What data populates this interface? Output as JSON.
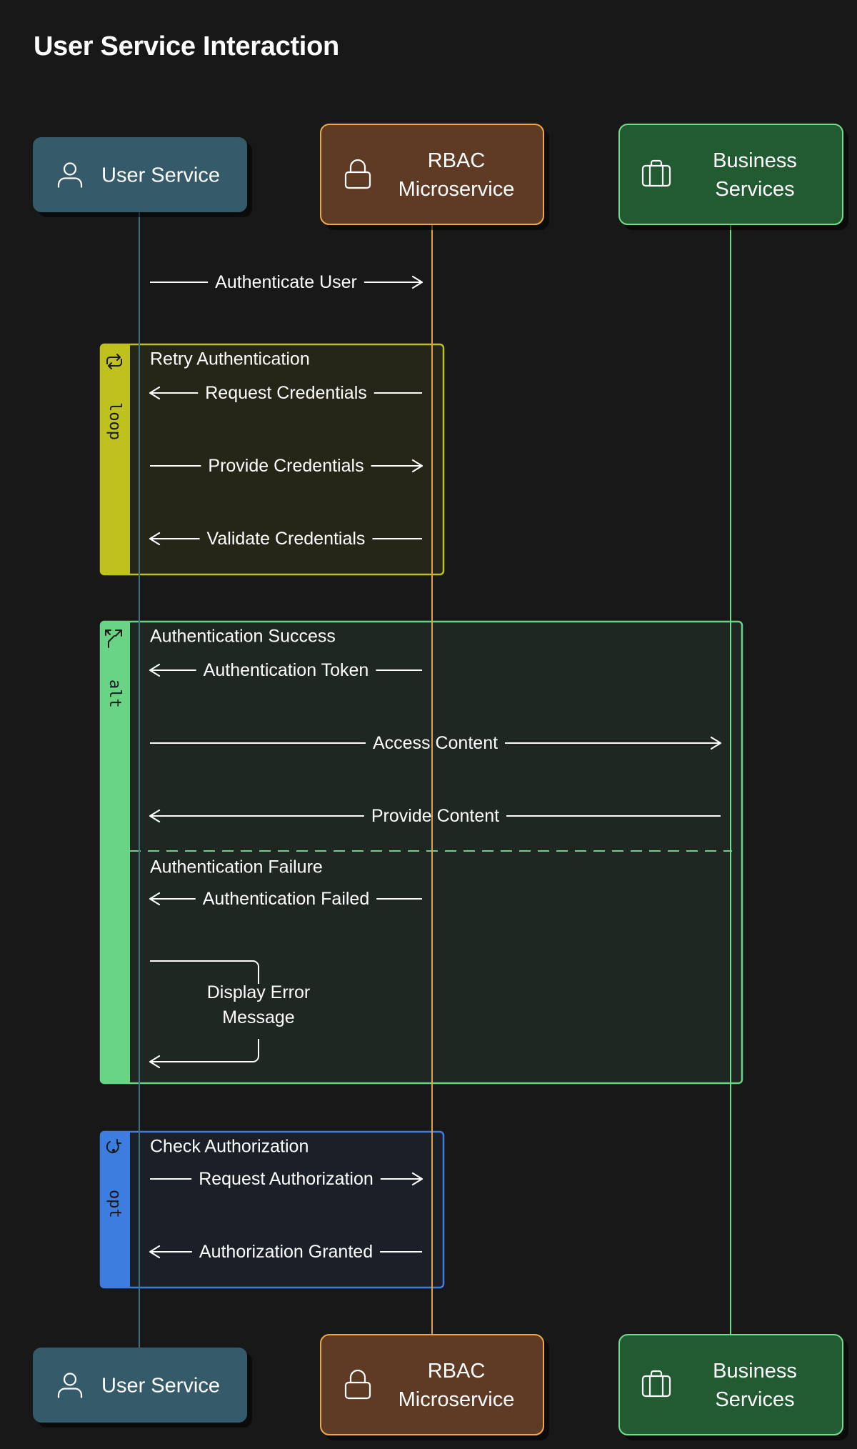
{
  "title": "User Service Interaction",
  "colors": {
    "background": "#181818",
    "user_service": {
      "fill": "#345a6b",
      "stroke": "#345a6b",
      "lifeline": "#3d6f7e"
    },
    "rbac": {
      "fill": "#5e3b26",
      "stroke": "#f0a745",
      "lifeline": "#e3a04a"
    },
    "business": {
      "fill": "#245a30",
      "stroke": "#6fdc8c",
      "lifeline": "#6fdc8c"
    },
    "loop": "#bfc11f",
    "alt": "#69d386",
    "opt": "#3e7de0"
  },
  "participants": [
    {
      "id": "user",
      "name": "User Service",
      "lines": [
        "User Service"
      ],
      "icon": "user-icon"
    },
    {
      "id": "rbac",
      "name": "RBAC Microservice",
      "lines": [
        "RBAC",
        "Microservice"
      ],
      "icon": "lock-icon"
    },
    {
      "id": "biz",
      "name": "Business Services",
      "lines": [
        "Business",
        "Services"
      ],
      "icon": "briefcase-icon"
    }
  ],
  "messages": [
    {
      "id": "authenticate-user",
      "from": "user",
      "to": "rbac",
      "label": "Authenticate User"
    },
    {
      "id": "request-credentials",
      "from": "rbac",
      "to": "user",
      "label": "Request Credentials"
    },
    {
      "id": "provide-credentials",
      "from": "user",
      "to": "rbac",
      "label": "Provide Credentials"
    },
    {
      "id": "validate-credentials",
      "from": "rbac",
      "to": "user",
      "label": "Validate Credentials"
    },
    {
      "id": "authentication-token",
      "from": "rbac",
      "to": "user",
      "label": "Authentication Token"
    },
    {
      "id": "access-content",
      "from": "user",
      "to": "biz",
      "label": "Access Content"
    },
    {
      "id": "provide-content",
      "from": "biz",
      "to": "user",
      "label": "Provide Content"
    },
    {
      "id": "authentication-failed",
      "from": "rbac",
      "to": "user",
      "label": "Authentication Failed"
    },
    {
      "id": "display-error-message",
      "from": "user",
      "to": "user",
      "label": "Display Error Message",
      "lines": [
        "Display Error",
        "Message"
      ]
    },
    {
      "id": "request-authorization",
      "from": "user",
      "to": "rbac",
      "label": "Request Authorization"
    },
    {
      "id": "authorization-granted",
      "from": "rbac",
      "to": "user",
      "label": "Authorization Granted"
    }
  ],
  "frames": [
    {
      "id": "loop",
      "type": "loop",
      "tag": "loop",
      "icon": "loop-icon",
      "label": "Retry Authentication",
      "first": 1,
      "last": 3
    },
    {
      "id": "alt",
      "type": "alt",
      "tag": "alt",
      "icon": "branch-icon",
      "label": "Authentication Success",
      "else_label": "Authentication Failure",
      "first": 4,
      "last": 8,
      "else_first": 7
    },
    {
      "id": "opt",
      "type": "opt",
      "tag": "opt",
      "icon": "option-icon",
      "label": "Check Authorization",
      "first": 9,
      "last": 10
    }
  ]
}
